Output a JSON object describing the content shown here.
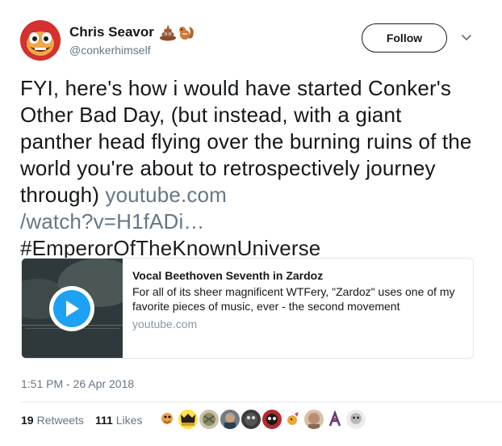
{
  "author": {
    "display_name": "Chris Seavor",
    "handle": "@conkerhimself",
    "emojis": [
      "pile-of-poo-emoji",
      "chipmunk-emoji"
    ]
  },
  "follow_label": "Follow",
  "tweet": {
    "text": "FYI, here's how i would have started Conker's Other Bad Day, (but instead, with a giant panther head flying over the burning ruins of the world you're about to retrospectively journey through)",
    "link_part1": "youtube.com",
    "link_part2": "/watch?v=H1fADi…",
    "hashtag": "#EmperorOfTheKnownUniverse"
  },
  "card": {
    "title": "Vocal Beethoven Seventh in Zardoz",
    "description": "For all of its sheer magnificent WTFery, \"Zardoz\" uses one of my favorite pieces of music, ever - the second movement",
    "domain": "youtube.com"
  },
  "timestamp": "1:51 PM - 26 Apr 2018",
  "stats": {
    "retweets_count": "19",
    "retweets_label": "Retweets",
    "likes_count": "111",
    "likes_label": "Likes"
  },
  "likers": [
    "liker-avatar-1",
    "liker-avatar-2",
    "liker-avatar-3",
    "liker-avatar-4",
    "liker-avatar-5",
    "liker-avatar-6",
    "liker-avatar-7",
    "liker-avatar-8",
    "liker-avatar-9",
    "liker-avatar-10"
  ],
  "colors": {
    "link": "#657786",
    "accent": "#1da1f2",
    "text": "#14171a"
  }
}
